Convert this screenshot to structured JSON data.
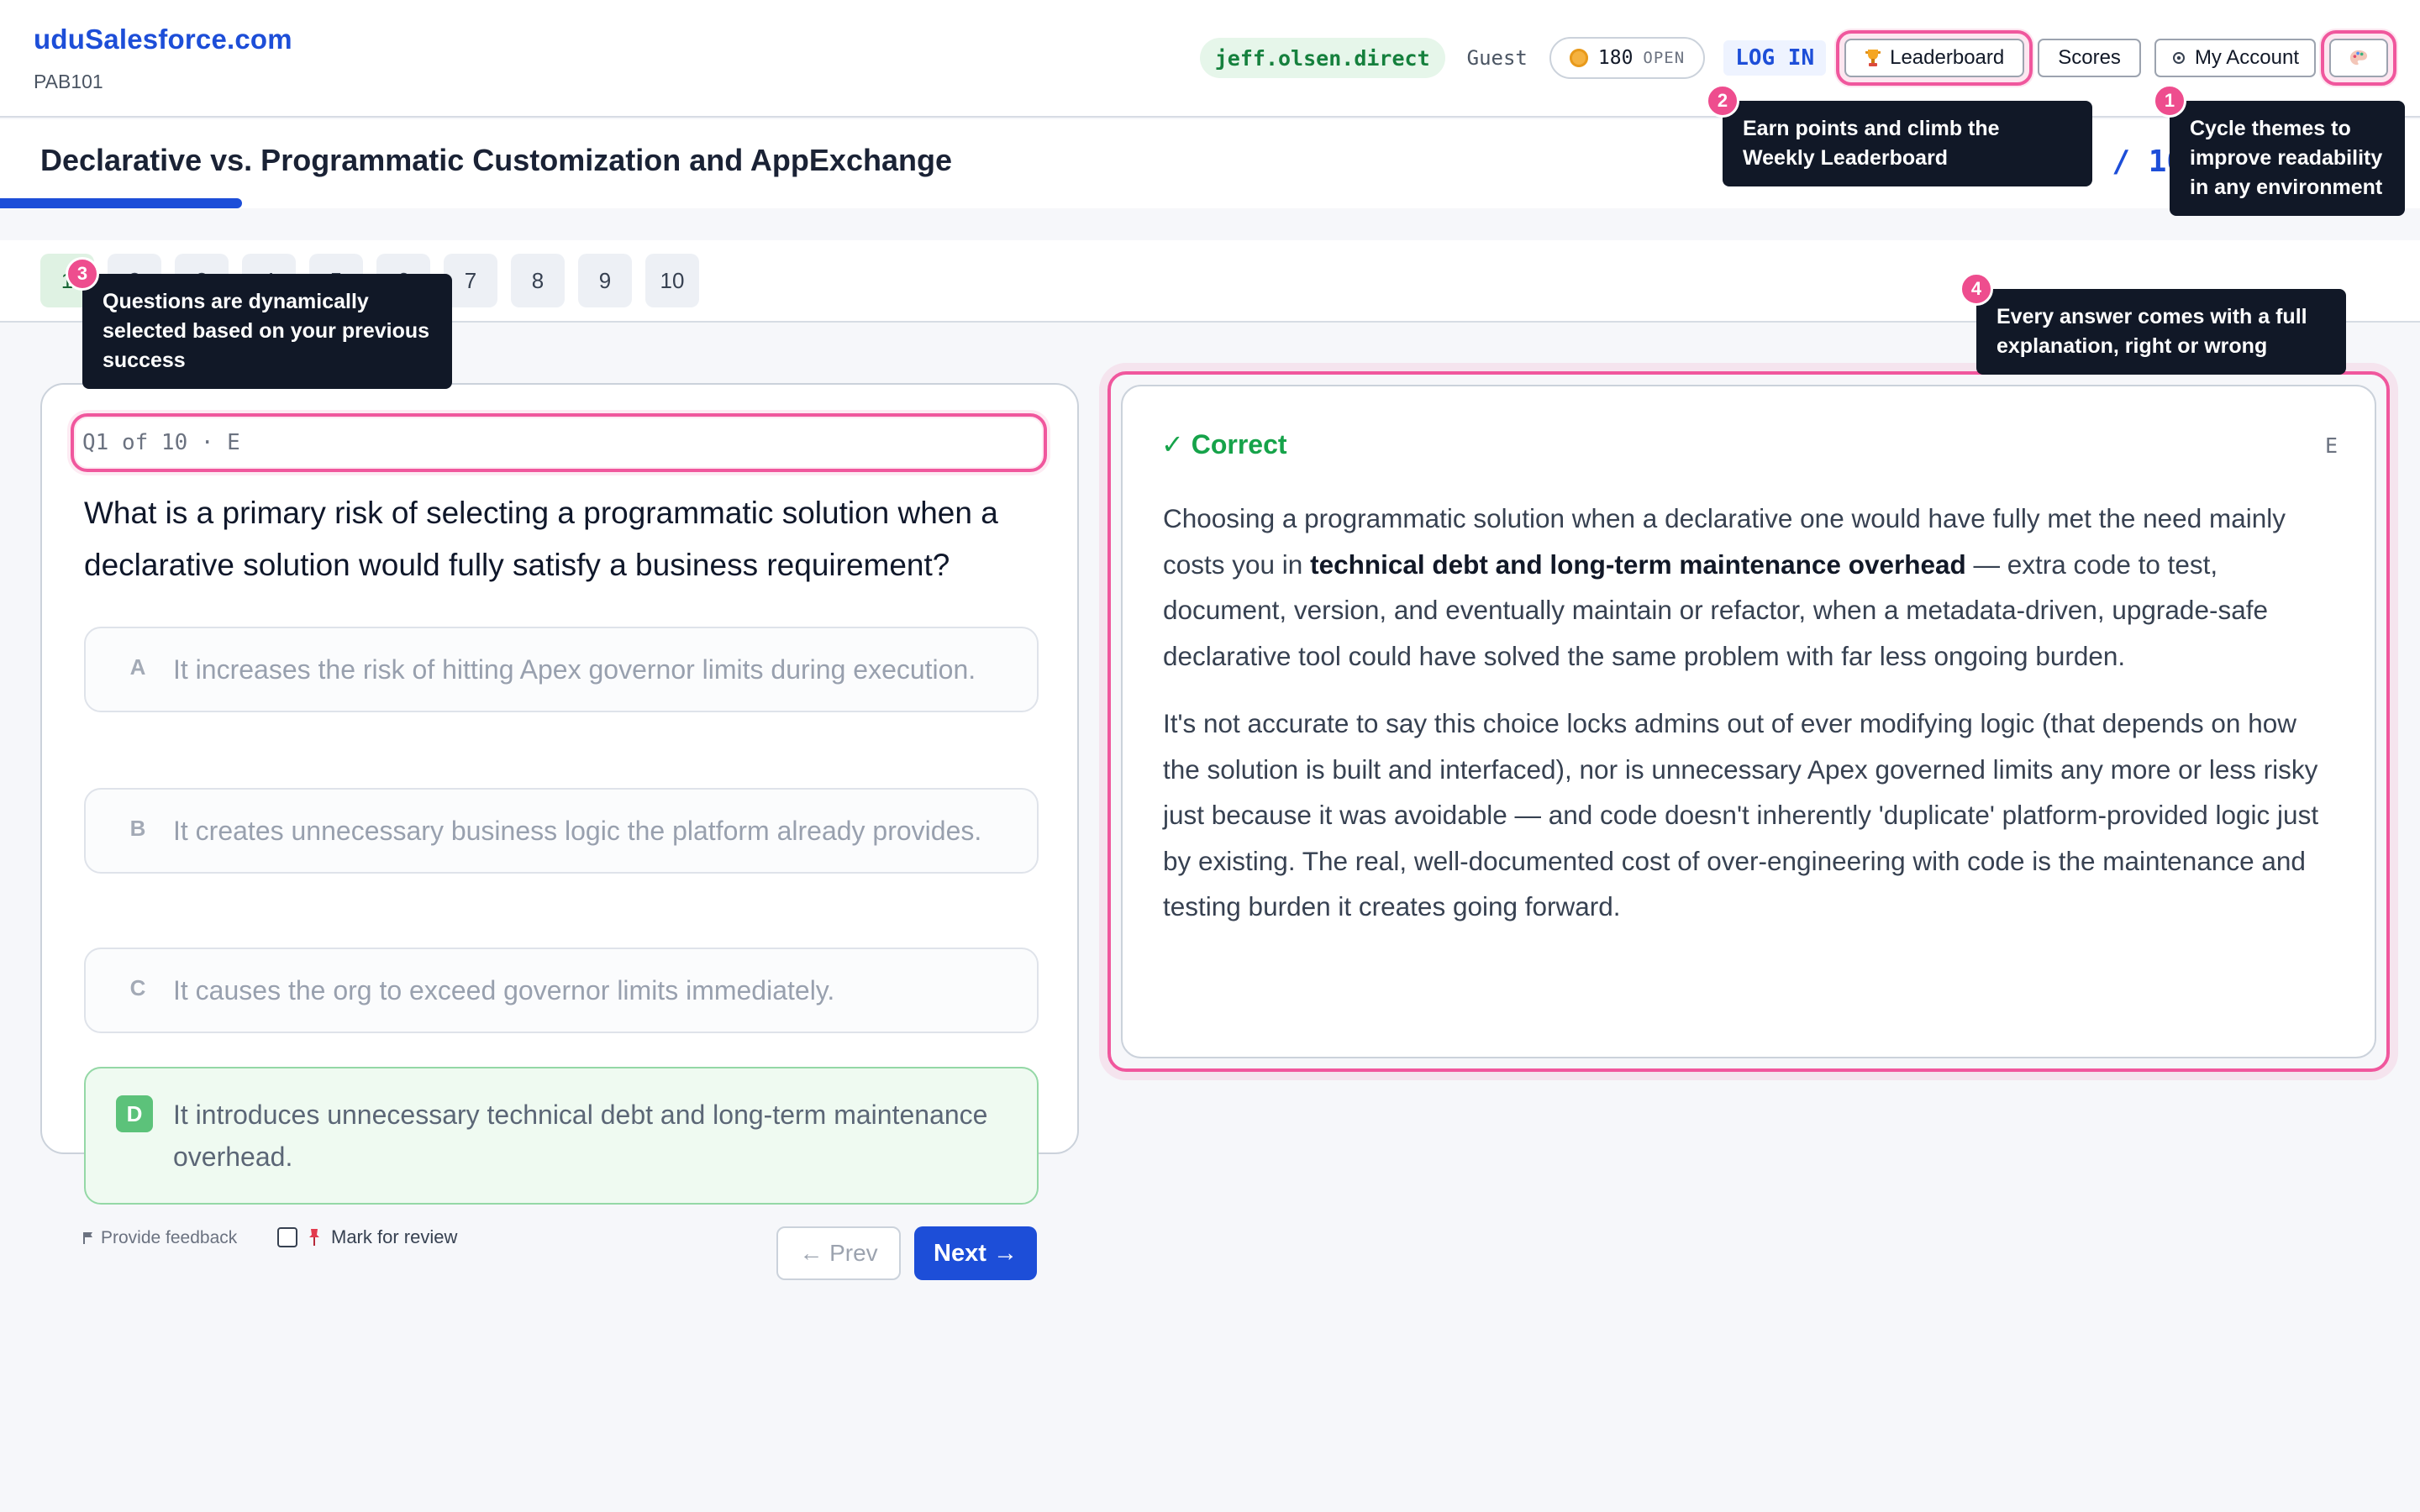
{
  "brand": {
    "title": "uduSalesforce.com",
    "subtitle": "PAB101"
  },
  "header": {
    "username": "jeff.olsen.direct",
    "guest_label": "Guest",
    "points": "180",
    "points_status": "OPEN",
    "login_label": "LOG IN",
    "leaderboard_label": "Leaderboard",
    "scores_label": "Scores",
    "account_label": "My Account"
  },
  "topic": {
    "title": "Declarative vs. Programmatic Customization and AppExchange",
    "progress_text": "1 / 10",
    "progress_fraction": 0.1
  },
  "question_nav": [
    "1",
    "2",
    "3",
    "4",
    "5",
    "6",
    "7",
    "8",
    "9",
    "10"
  ],
  "question": {
    "meta": "Q1 of 10 · E",
    "text": "What is a primary risk of selecting a programmatic solution when a declarative solution would fully satisfy a business requirement?",
    "options": [
      {
        "letter": "A",
        "text": "It increases the risk of hitting Apex governor limits during execution."
      },
      {
        "letter": "B",
        "text": "It creates unnecessary business logic the platform already provides."
      },
      {
        "letter": "C",
        "text": "It causes the org to exceed governor limits immediately."
      },
      {
        "letter": "D",
        "text": "It introduces unnecessary technical debt and long-term maintenance overhead."
      }
    ],
    "feedback_label": "Provide feedback",
    "mark_label": "Mark for review",
    "prev_label": "← Prev",
    "next_label": "Next →"
  },
  "explanation": {
    "status": "✓ Correct",
    "difficulty": "E",
    "p1_pre": "Choosing a programmatic solution when a declarative one would have fully met the need mainly costs you in ",
    "p1_bold": "technical debt and long-term maintenance overhead",
    "p1_post": " — extra code to test, document, version, and eventually maintain or refactor, when a metadata-driven, upgrade-safe declarative tool could have solved the same problem with far less ongoing burden.",
    "p2": "It's not accurate to say this choice locks admins out of ever modifying logic (that depends on how the solution is built and interfaced), nor is unnecessary Apex governed limits any more or less risky just because it was avoidable — and code doesn't inherently 'duplicate' platform-provided logic just by existing. The real, well-documented cost of over-engineering with code is the maintenance and testing burden it creates going forward."
  },
  "tips": [
    {
      "num": "1",
      "text": "Cycle themes to improve readability in any environment"
    },
    {
      "num": "2",
      "text": "Earn points and climb the Weekly Leaderboard"
    },
    {
      "num": "3",
      "text": "Questions are dynamically selected based on your previous success"
    },
    {
      "num": "4",
      "text": "Every answer comes with a full explanation, right or wrong"
    }
  ],
  "colors": {
    "accent": "#1d4ed8",
    "success": "#16a34a",
    "highlight": "#f0579d",
    "tooltip": "#111827"
  }
}
